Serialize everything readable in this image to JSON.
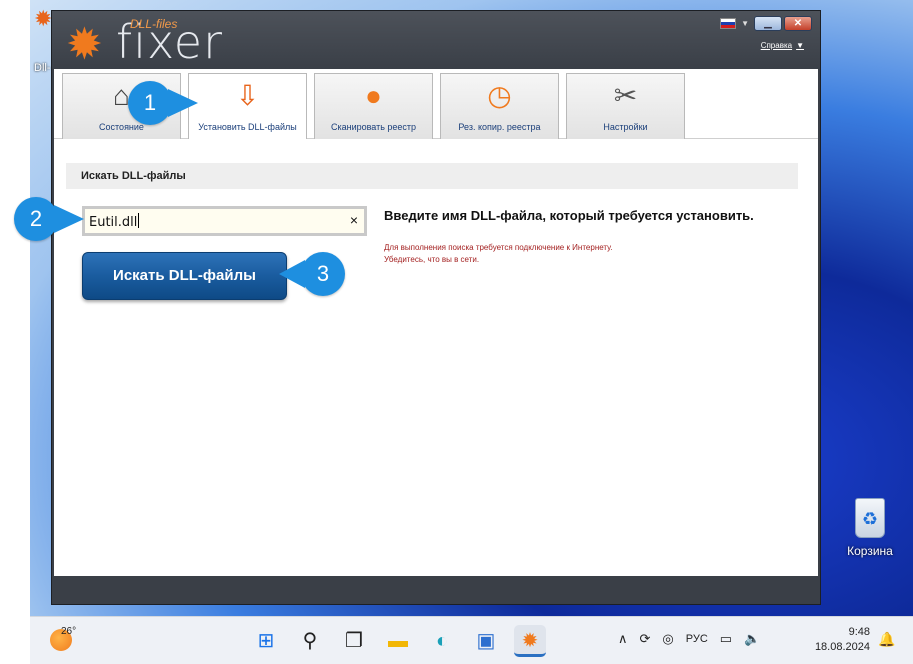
{
  "desktop": {
    "left_icon_label": "Dll-",
    "recycle_bin_label": "Корзина"
  },
  "app": {
    "logo_small": "DLL-files",
    "logo_big": "fixer",
    "help_label": "Справка",
    "tabs": [
      {
        "label": "Состояние",
        "icon": "home-icon"
      },
      {
        "label": "Установить DLL-файлы",
        "icon": "install-download-icon"
      },
      {
        "label": "Сканировать реестр",
        "icon": "magnifier-icon"
      },
      {
        "label": "Рез. копир. реестра",
        "icon": "backup-clock-icon"
      },
      {
        "label": "Настройки",
        "icon": "tools-icon"
      }
    ],
    "section_title": "Искать DLL-файлы",
    "search_value": "Eutil.dll",
    "search_clear": "×",
    "search_button": "Искать DLL-файлы",
    "instruction": "Введите имя DLL-файла, который требуется установить.",
    "note_line1": "Для выполнения поиска требуется подключение к Интернету.",
    "note_line2": "Убедитесь, что вы в сети."
  },
  "callouts": [
    "1",
    "2",
    "3"
  ],
  "taskbar": {
    "weather_temp": "26°",
    "language": "РУС",
    "time": "9:48",
    "date": "18.08.2024",
    "pinned": [
      "windows-start-icon",
      "search-icon",
      "task-view-icon",
      "file-explorer-icon",
      "edge-browser-icon",
      "store-icon",
      "dll-fixer-icon"
    ]
  },
  "colors": {
    "accent_blue": "#1e8fe0",
    "button_blue": "#1a5c9f",
    "logo_orange": "#f07a1e",
    "note_red": "#a42222"
  }
}
